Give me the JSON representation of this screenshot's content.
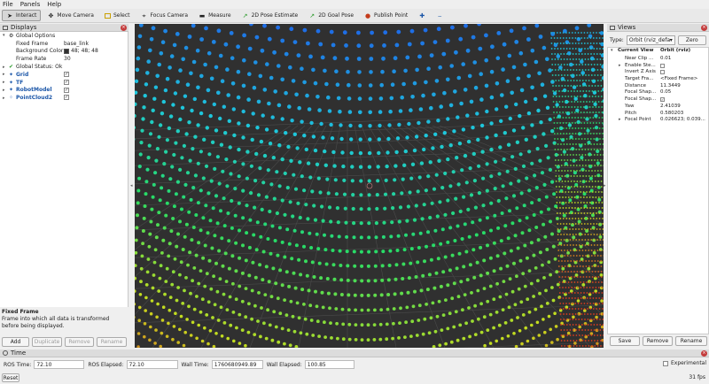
{
  "menu": [
    "File",
    "Panels",
    "Help"
  ],
  "toolbar": [
    {
      "label": "Interact",
      "icon": "interact-icon",
      "active": true
    },
    {
      "label": "Move Camera",
      "icon": "move-camera-icon"
    },
    {
      "label": "Select",
      "icon": "select-icon"
    },
    {
      "label": "Focus Camera",
      "icon": "focus-camera-icon"
    },
    {
      "label": "Measure",
      "icon": "measure-icon"
    },
    {
      "label": "2D Pose Estimate",
      "icon": "pose-estimate-icon"
    },
    {
      "label": "2D Goal Pose",
      "icon": "goal-pose-icon"
    },
    {
      "label": "Publish Point",
      "icon": "publish-point-icon"
    },
    {
      "label": "",
      "icon": "crosshair-icon"
    },
    {
      "label": "",
      "icon": "minus-icon"
    }
  ],
  "displays": {
    "title": "Displays",
    "global_options": "Global Options",
    "fixed_frame_label": "Fixed Frame",
    "fixed_frame_value": "base_link",
    "background_label": "Background Color",
    "background_value": "48; 48; 48",
    "frame_rate_label": "Frame Rate",
    "frame_rate_value": "30",
    "global_status": "Global Status: Ok",
    "grid": "Grid",
    "tf": "TF",
    "robot_model": "RobotModel",
    "pointcloud": "PointCloud2",
    "desc_title": "Fixed Frame",
    "desc_text": "Frame into which all data is transformed before being displayed.",
    "buttons": {
      "add": "Add",
      "duplicate": "Duplicate",
      "remove": "Remove",
      "rename": "Rename"
    }
  },
  "views": {
    "title": "Views",
    "type_label": "Type:",
    "type_value": "Orbit (rviz_defau",
    "zero": "Zero",
    "current_view": "Current View",
    "current_view_value": "Orbit (rviz)",
    "rows": [
      {
        "label": "Near Clip ...",
        "value": "0.01"
      },
      {
        "label": "Enable Ste...",
        "value": "",
        "check": true,
        "checked": false,
        "arrow": true
      },
      {
        "label": "Invert Z Axis",
        "value": "",
        "check": true,
        "checked": false
      },
      {
        "label": "Target Fra...",
        "value": "<Fixed Frame>"
      },
      {
        "label": "Distance",
        "value": "11.3449"
      },
      {
        "label": "Focal Shap...",
        "value": "0.05"
      },
      {
        "label": "Focal Shap...",
        "value": "",
        "check": true,
        "checked": true
      },
      {
        "label": "Yaw",
        "value": "2.41039"
      },
      {
        "label": "Pitch",
        "value": "0.580203"
      },
      {
        "label": "Focal Point",
        "value": "0.026623; 0.039...",
        "arrow": true
      }
    ],
    "buttons": {
      "save": "Save",
      "remove": "Remove",
      "rename": "Rename"
    }
  },
  "time": {
    "title": "Time",
    "ros_time_label": "ROS Time:",
    "ros_time": "72.10",
    "ros_elapsed_label": "ROS Elapsed:",
    "ros_elapsed": "72.10",
    "wall_time_label": "Wall Time:",
    "wall_time": "1760680949.89",
    "wall_elapsed_label": "Wall Elapsed:",
    "wall_elapsed": "100.85",
    "experimental": "Experimental",
    "reset": "Reset",
    "fps": "31 fps"
  },
  "colors": {
    "viewport_bg": "#303030",
    "accent": "#1b56a8"
  }
}
